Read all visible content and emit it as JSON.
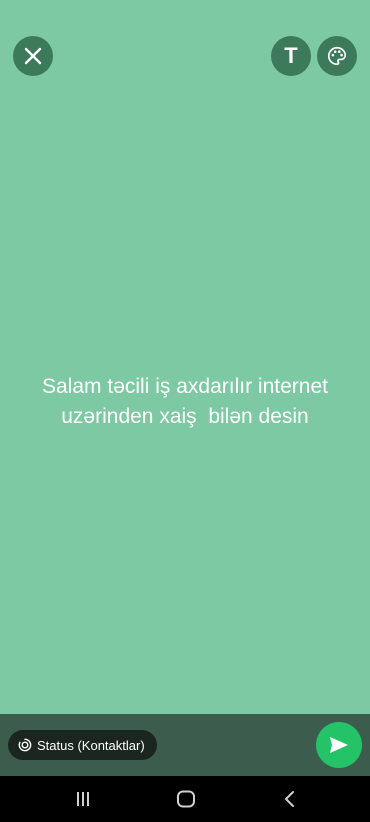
{
  "toolbar": {
    "close_icon": "close-icon",
    "text_tool_label": "T",
    "palette_icon": "palette-icon"
  },
  "status": {
    "text": "Salam təcili iş axdarılır internet\nuzərinden xaiş  bilən desin",
    "background_color": "#7dc9a3"
  },
  "footer": {
    "audience_label": "Status (Kontaktlar)",
    "audience_icon": "status-icon",
    "send_icon": "send-icon"
  },
  "nav": {
    "recents_icon": "recents-icon",
    "home_icon": "home-icon",
    "back_icon": "back-icon"
  }
}
